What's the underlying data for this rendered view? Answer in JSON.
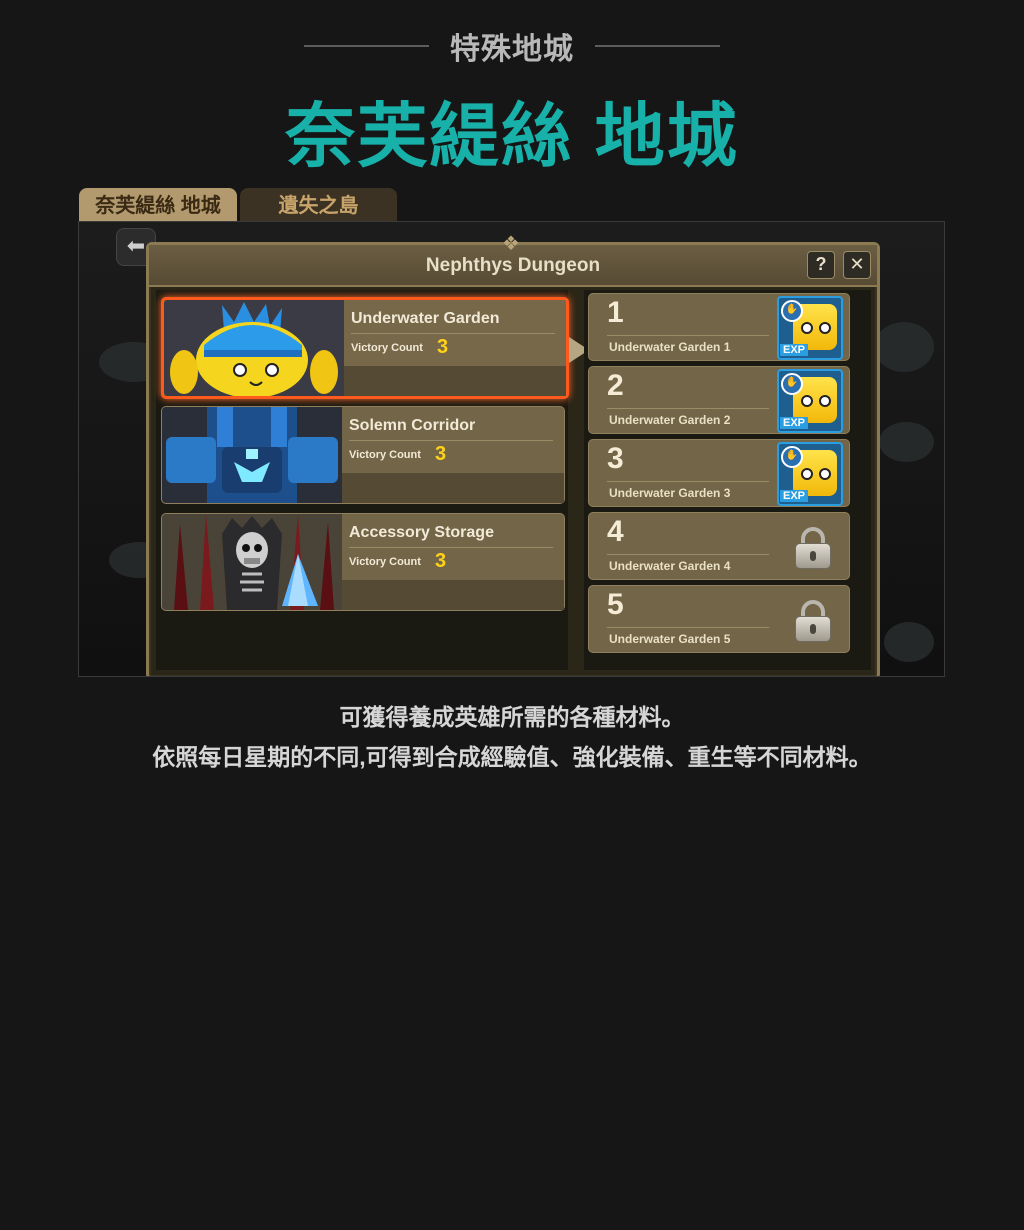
{
  "header": {
    "kicker": "特殊地城",
    "title": "奈芙緹絲 地城"
  },
  "tabs": [
    {
      "label": "奈芙緹絲 地城",
      "active": true
    },
    {
      "label": "遺失之島",
      "active": false
    }
  ],
  "game": {
    "panel_title": "Nephthys Dungeon",
    "help_label": "?",
    "close_label": "✕",
    "back_label": "⬅",
    "dungeons": [
      {
        "name": "Underwater Garden",
        "victory_label": "Victory Count",
        "victory_count": "3",
        "selected": true
      },
      {
        "name": "Solemn Corridor",
        "victory_label": "Victory Count",
        "victory_count": "3",
        "selected": false
      },
      {
        "name": "Accessory Storage",
        "victory_label": "Victory Count",
        "victory_count": "3",
        "selected": false
      }
    ],
    "stages": [
      {
        "number": "1",
        "label": "Underwater Garden 1",
        "state": "exp",
        "badge": "EXP"
      },
      {
        "number": "2",
        "label": "Underwater Garden 2",
        "state": "exp",
        "badge": "EXP"
      },
      {
        "number": "3",
        "label": "Underwater Garden 3",
        "state": "exp",
        "badge": "EXP"
      },
      {
        "number": "4",
        "label": "Underwater Garden 4",
        "state": "locked"
      },
      {
        "number": "5",
        "label": "Underwater Garden 5",
        "state": "locked"
      }
    ]
  },
  "description": {
    "line1": "可獲得養成英雄所需的各種材料。",
    "line2": "依照每日星期的不同,可得到合成經驗值、強化裝備、重生等不同材料。"
  },
  "colors": {
    "title": "#18b1aa",
    "background": "#161616",
    "victory_count": "#ffd21a",
    "selected_border": "#ff5a1e"
  }
}
